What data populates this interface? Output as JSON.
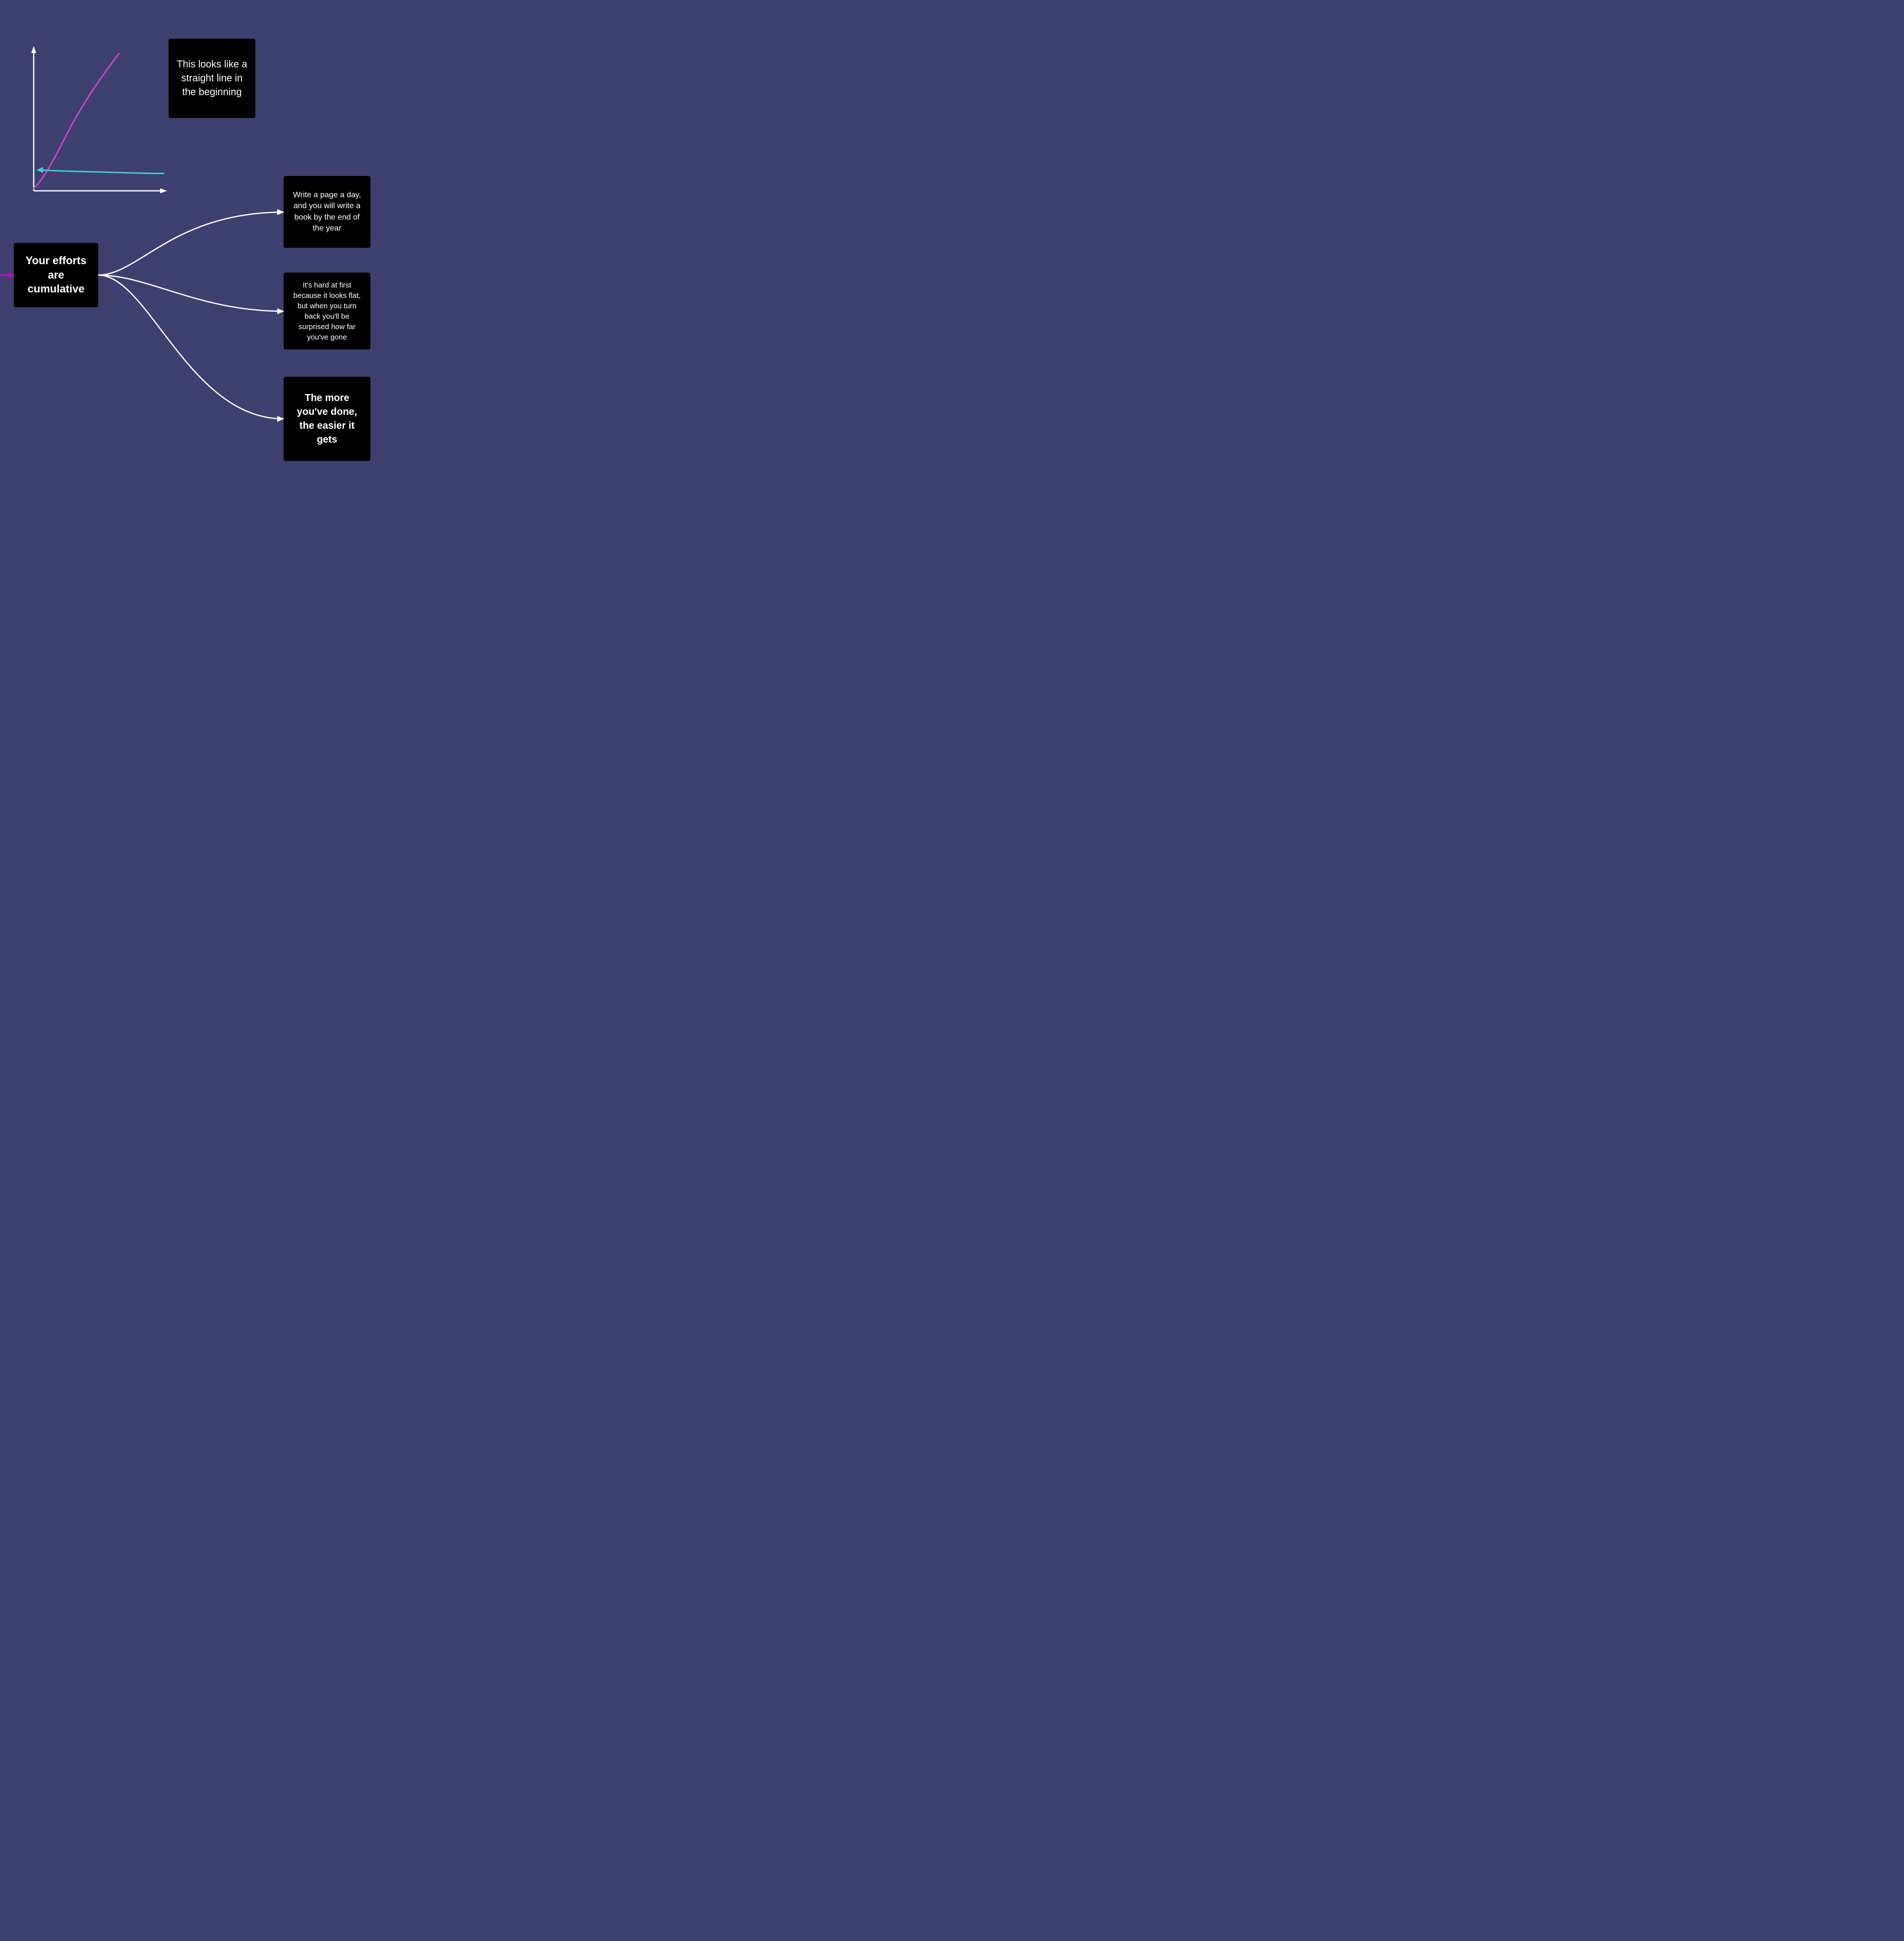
{
  "background": "#3d3f6e",
  "cards": {
    "straight_line": {
      "text": "This looks like a straight line in the beginning"
    },
    "efforts": {
      "text": "Your efforts are cumulative"
    },
    "write_page": {
      "text": "Write a page a day, and you will write a book by the end of the year"
    },
    "hard_first": {
      "text": "It's hard at first because it looks flat, but when you turn back you'll be surprised how far you've gone"
    },
    "more_done": {
      "text": "The more you've done, the easier it gets"
    }
  },
  "colors": {
    "purple_curve": "#cc44cc",
    "teal_curve": "#44cccc",
    "white_arrow": "#ffffff",
    "magenta_arrow": "#cc00cc"
  }
}
